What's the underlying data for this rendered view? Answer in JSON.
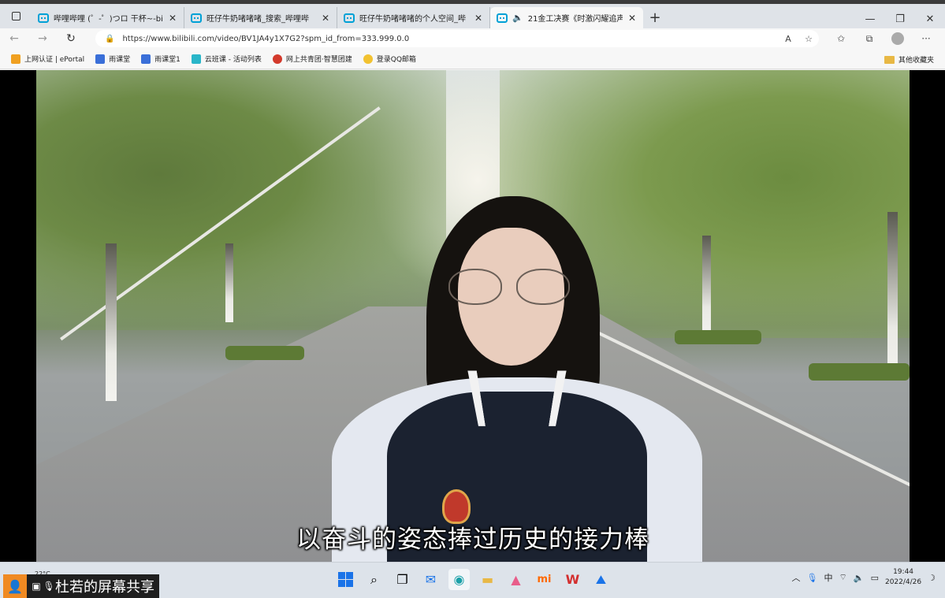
{
  "browser": {
    "tabs": [
      {
        "title": "哔哩哔哩 (゜-゜)つロ 干杯~-bilil",
        "active": false
      },
      {
        "title": "旺仔牛奶啫啫啫_搜索_哔哩哔",
        "active": false
      },
      {
        "title": "旺仔牛奶啫啫啫的个人空间_哔",
        "active": false
      },
      {
        "title": "21金工决赛《时激闪耀追声",
        "active": true
      }
    ],
    "url": "https://www.bilibili.com/video/BV1JA4y1X7G2?spm_id_from=333.999.0.0",
    "bookmarks": [
      {
        "label": "上网认证 | ePortal",
        "color": "#f0a020"
      },
      {
        "label": "雨课堂",
        "color": "#3a6fd8"
      },
      {
        "label": "雨课堂1",
        "color": "#3a6fd8"
      },
      {
        "label": "云班课 - 活动列表",
        "color": "#29b6c9"
      },
      {
        "label": "网上共青团·智慧团建",
        "color": "#d33a2c"
      },
      {
        "label": "登录QQ邮箱",
        "color": "#f2c230"
      }
    ],
    "other_bookmarks": "其他收藏夹"
  },
  "video": {
    "subtitle": "以奋斗的姿态捧过历史的接力棒"
  },
  "taskbar": {
    "weather_temp": "22°C",
    "share_label": "杜若的屏幕共享",
    "ime": "中",
    "time": "19:44",
    "date": "2022/4/26"
  }
}
